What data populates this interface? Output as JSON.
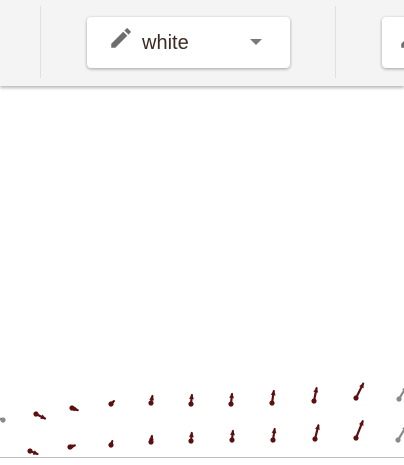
{
  "toolbar": {
    "color_select": {
      "value": "white",
      "icon": "pencil-icon"
    },
    "next_control": {
      "icon": "pencil-icon"
    }
  },
  "colors": {
    "toolbar_bg": "#f4f4f4",
    "arrow_dark": "#5a1010",
    "arrow_gray": "#8a8a8a"
  }
}
